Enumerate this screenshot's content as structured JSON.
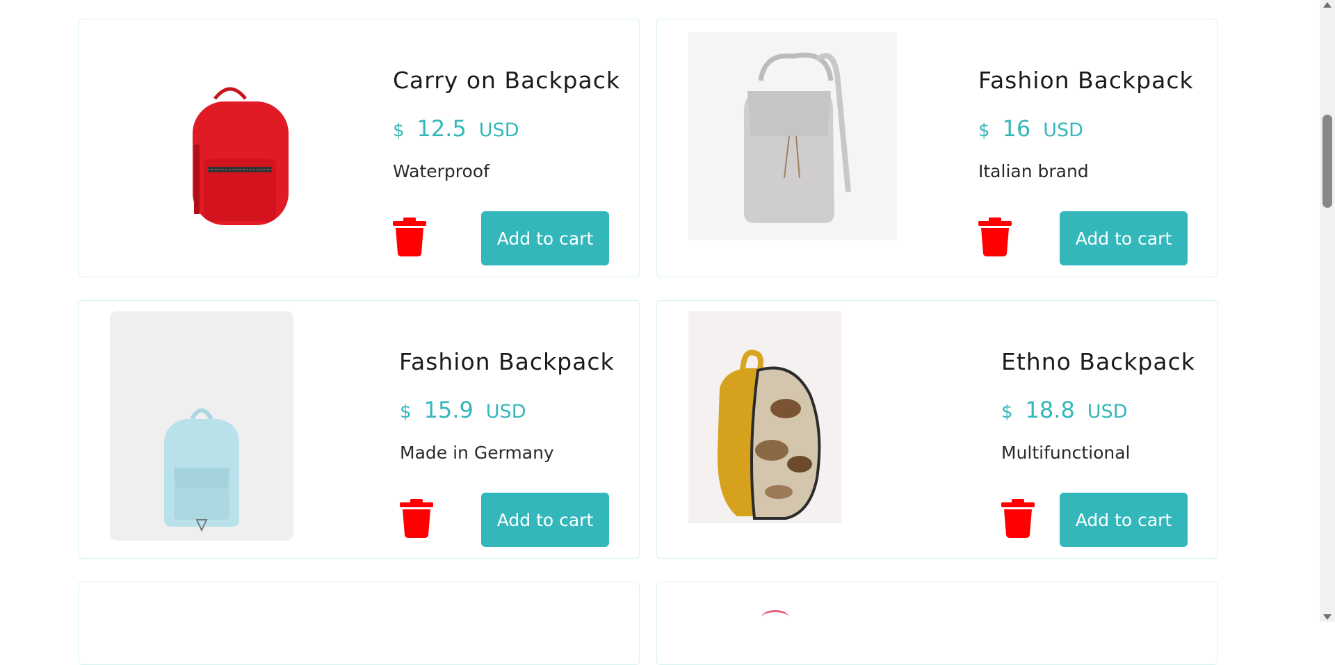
{
  "products": [
    {
      "title": "Carry on Backpack",
      "currency_symbol": "$",
      "price": "12.5",
      "currency": "USD",
      "description": "Waterproof",
      "button_label": "Add to cart",
      "image": "red-backpack-image"
    },
    {
      "title": "Fashion Backpack",
      "currency_symbol": "$",
      "price": "16",
      "currency": "USD",
      "description": "Italian brand",
      "button_label": "Add to cart",
      "image": "gray-backpack-image"
    },
    {
      "title": "Fashion Backpack",
      "currency_symbol": "$",
      "price": "15.9",
      "currency": "USD",
      "description": "Made in Germany",
      "button_label": "Add to cart",
      "image": "light-blue-backpack-image"
    },
    {
      "title": "Ethno Backpack",
      "currency_symbol": "$",
      "price": "18.8",
      "currency": "USD",
      "description": "Multifunctional",
      "button_label": "Add to cart",
      "image": "ethno-backpack-image"
    }
  ],
  "colors": {
    "accent": "#33b7bb",
    "delete": "#ff0000",
    "card_border": "#d9f1f1"
  }
}
